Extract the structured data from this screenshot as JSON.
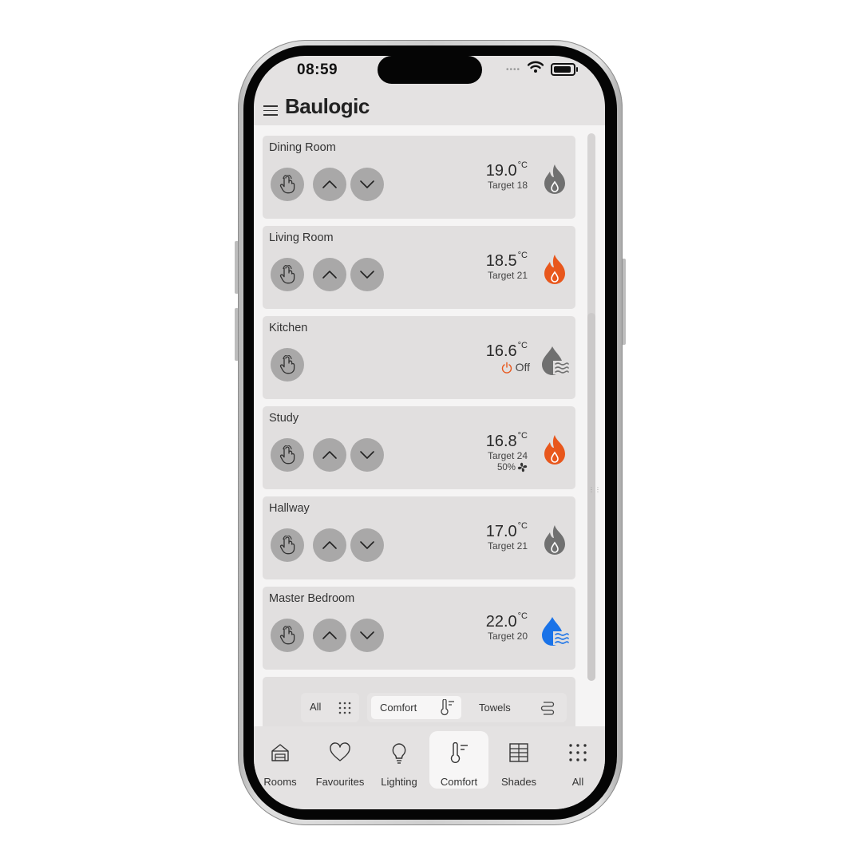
{
  "status": {
    "time": "08:59"
  },
  "header": {
    "title": "Baulogic"
  },
  "colors": {
    "heating_active": "#e8571c",
    "idle": "#707070",
    "cooling": "#1a73e8",
    "off_icon": "#e8571c"
  },
  "rooms": [
    {
      "name": "Dining Room",
      "temp": "19.0",
      "unit": "°C",
      "target": "Target 18",
      "has_arrows": true,
      "mode": "flame",
      "mode_color": "idle"
    },
    {
      "name": "Living Room",
      "temp": "18.5",
      "unit": "°C",
      "target": "Target 21",
      "has_arrows": true,
      "mode": "flame",
      "mode_color": "heating_active"
    },
    {
      "name": "Kitchen",
      "temp": "16.6",
      "unit": "°C",
      "off_label": "Off",
      "has_arrows": false,
      "mode": "drop-waves",
      "mode_color": "idle"
    },
    {
      "name": "Study",
      "temp": "16.8",
      "unit": "°C",
      "target": "Target 24",
      "fan": "50%",
      "has_arrows": true,
      "mode": "flame",
      "mode_color": "heating_active"
    },
    {
      "name": "Hallway",
      "temp": "17.0",
      "unit": "°C",
      "target": "Target 21",
      "has_arrows": true,
      "mode": "flame",
      "mode_color": "idle"
    },
    {
      "name": "Master Bedroom",
      "temp": "22.0",
      "unit": "°C",
      "target": "Target 20",
      "has_arrows": true,
      "mode": "drop-waves",
      "mode_color": "cooling"
    }
  ],
  "filters": {
    "all_label": "All",
    "comfort_label": "Comfort",
    "towels_label": "Towels",
    "selected": "Comfort"
  },
  "nav": {
    "items": [
      {
        "label": "Rooms",
        "icon": "house-icon"
      },
      {
        "label": "Favourites",
        "icon": "heart-icon"
      },
      {
        "label": "Lighting",
        "icon": "bulb-icon"
      },
      {
        "label": "Comfort",
        "icon": "thermometer-icon"
      },
      {
        "label": "Shades",
        "icon": "shades-icon"
      },
      {
        "label": "All",
        "icon": "grid-icon"
      }
    ],
    "active": "Comfort"
  }
}
